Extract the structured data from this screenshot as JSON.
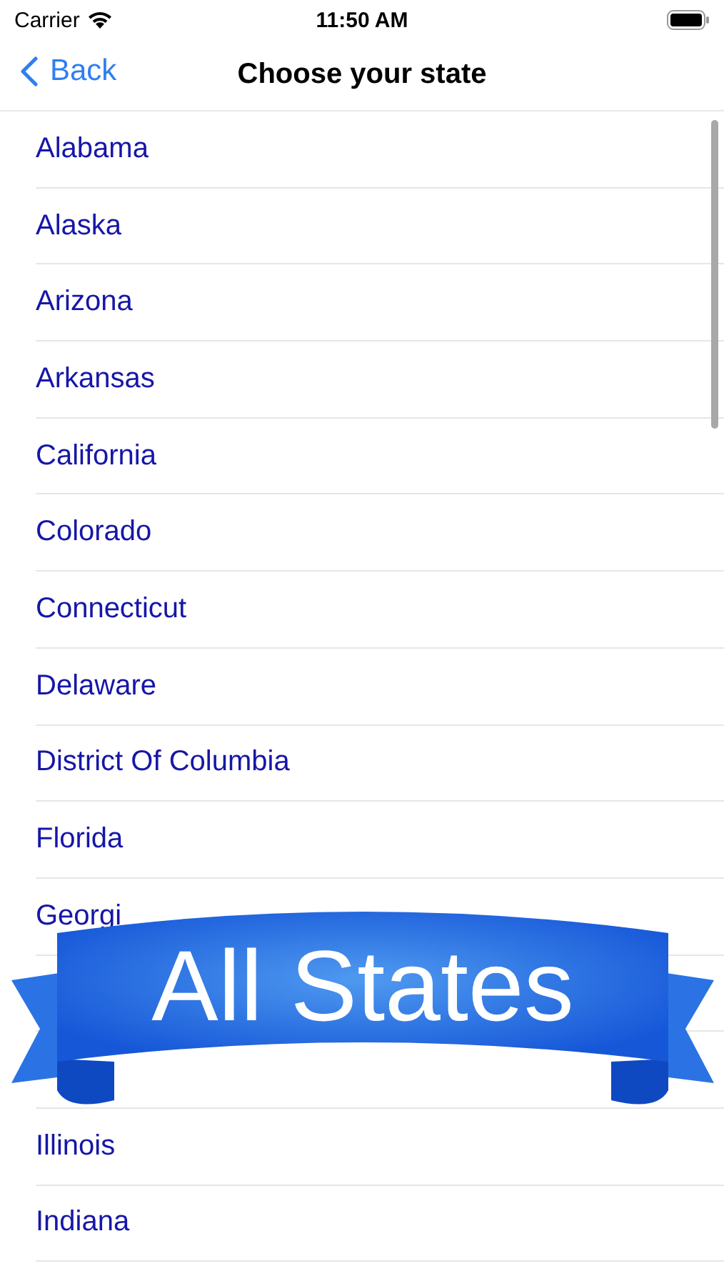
{
  "status_bar": {
    "carrier": "Carrier",
    "time": "11:50 AM"
  },
  "nav": {
    "back": "Back",
    "title": "Choose your state"
  },
  "states": [
    {
      "name": "Alabama"
    },
    {
      "name": "Alaska"
    },
    {
      "name": "Arizona"
    },
    {
      "name": "Arkansas"
    },
    {
      "name": "California"
    },
    {
      "name": "Colorado"
    },
    {
      "name": "Connecticut"
    },
    {
      "name": "Delaware"
    },
    {
      "name": "District Of Columbia"
    },
    {
      "name": "Florida"
    },
    {
      "name": "Georgi"
    },
    {
      "name": "Illinois"
    },
    {
      "name": "Indiana"
    }
  ],
  "banner": {
    "text": "All States"
  }
}
